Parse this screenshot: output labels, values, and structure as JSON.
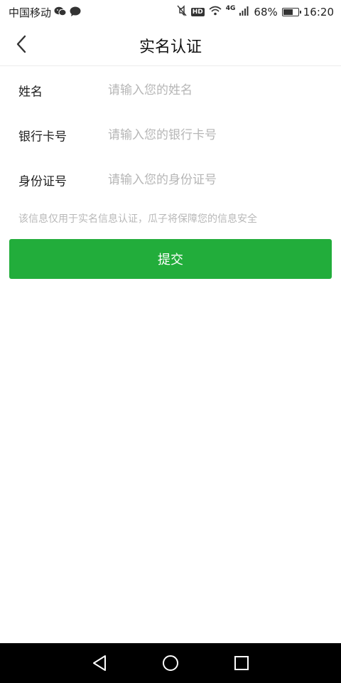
{
  "status_bar": {
    "carrier": "中国移动",
    "hd": "HD",
    "network": "4G",
    "battery": "68%",
    "battery_level": 0.68,
    "time": "16:20"
  },
  "header": {
    "title": "实名认证",
    "back_icon": "chevron-left-icon"
  },
  "form": {
    "fields": [
      {
        "label": "姓名",
        "placeholder": "请输入您的姓名",
        "value": ""
      },
      {
        "label": "银行卡号",
        "placeholder": "请输入您的银行卡号",
        "value": ""
      },
      {
        "label": "身份证号",
        "placeholder": "请输入您的身份证号",
        "value": ""
      }
    ],
    "notice": "该信息仅用于实名信息认证，瓜子将保障您的信息安全",
    "submit_label": "提交"
  },
  "system_nav": {
    "back_icon": "triangle-back-icon",
    "home_icon": "circle-home-icon",
    "recents_icon": "square-recents-icon"
  },
  "colors": {
    "accent": "#22ad3b",
    "placeholder": "#b6b6b6",
    "notice": "#b8b8b8"
  }
}
